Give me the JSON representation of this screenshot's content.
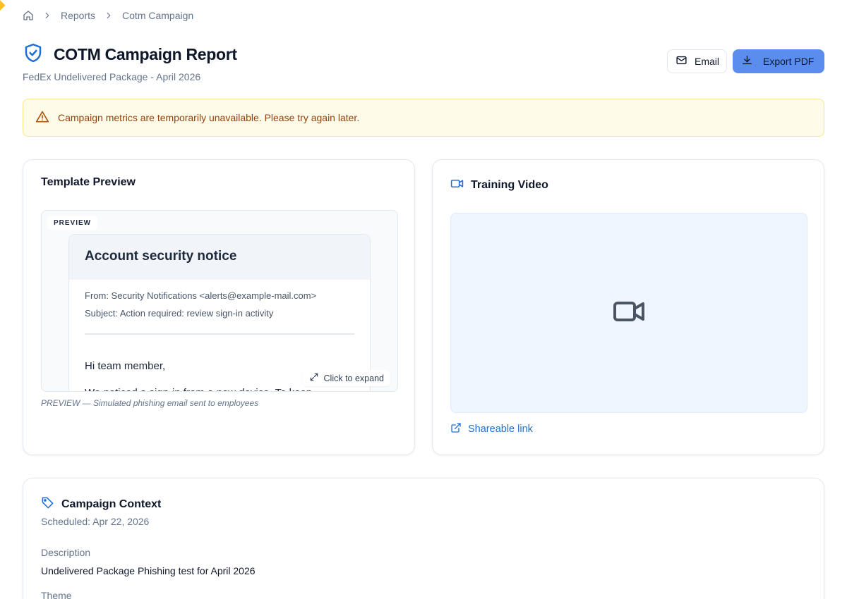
{
  "breadcrumb": {
    "items": [
      "Reports",
      "Cotm Campaign"
    ]
  },
  "header": {
    "title": "COTM Campaign Report",
    "subtitle": "FedEx Undelivered Package - April 2026",
    "email_label": "Email",
    "export_label": "Export PDF"
  },
  "alert": {
    "message": "Campaign metrics are temporarily unavailable. Please try again later."
  },
  "template_preview": {
    "title": "Template Preview",
    "tag": "PREVIEW",
    "email": {
      "heading": "Account security notice",
      "from": "From: Security Notifications <alerts@example-mail.com>",
      "subject": "Subject: Action required: review sign-in activity",
      "greeting": "Hi team member,",
      "body_line": "We noticed a sign-in from a new device. To keep"
    },
    "expand_label": "Click to expand",
    "caption": "PREVIEW — Simulated phishing email sent to employees"
  },
  "training_video": {
    "title": "Training Video",
    "link_label": "Shareable link"
  },
  "campaign_context": {
    "title": "Campaign Context",
    "scheduled": "Scheduled: Apr 22, 2026",
    "description_label": "Description",
    "description_value": "Undelivered Package Phishing test for April 2026",
    "theme_label": "Theme"
  },
  "colors": {
    "accent": "#5b8def",
    "link": "#1d6fd6",
    "warning_bg": "#fefce8",
    "warning_text": "#92400e"
  },
  "icons": [
    "home-icon",
    "chevron-right-icon",
    "shield-check-icon",
    "mail-icon",
    "download-icon",
    "warning-icon",
    "expand-icon",
    "video-icon",
    "external-link-icon",
    "tag-icon"
  ]
}
